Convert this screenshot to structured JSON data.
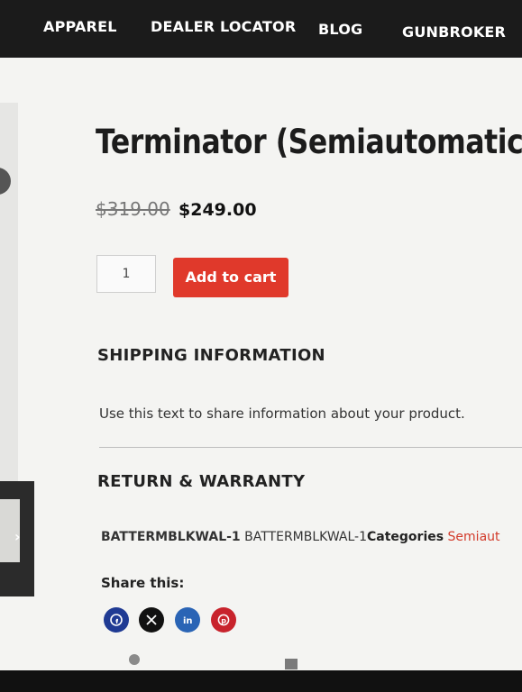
{
  "nav": {
    "items": [
      "APPAREL",
      "DEALER LOCATOR",
      "BLOG",
      "GUNBROKER"
    ]
  },
  "product": {
    "title": "Terminator (Semiautomatic), Bla",
    "old_price": "$319.00",
    "price": "$249.00",
    "quantity": "1",
    "add_to_cart": "Add to cart"
  },
  "shipping": {
    "heading": "SHIPPING INFORMATION",
    "text": "Use this text to share information about your product."
  },
  "returns": {
    "heading": "RETURN & WARRANTY"
  },
  "meta": {
    "sku_label": "BATTERMBLKWAL-1",
    "sku_value": "BATTERMBLKWAL-1",
    "categories_label": "Categories",
    "categories_value": "Semiaut"
  },
  "share": {
    "title": "Share this:",
    "icons": [
      "facebook-icon",
      "x-icon",
      "linkedin-icon",
      "pinterest-icon"
    ]
  },
  "colors": {
    "accent": "#e0392b",
    "facebook": "#1f3a93",
    "x": "#111111",
    "linkedin": "#2a64b5",
    "pinterest": "#c8232c"
  }
}
